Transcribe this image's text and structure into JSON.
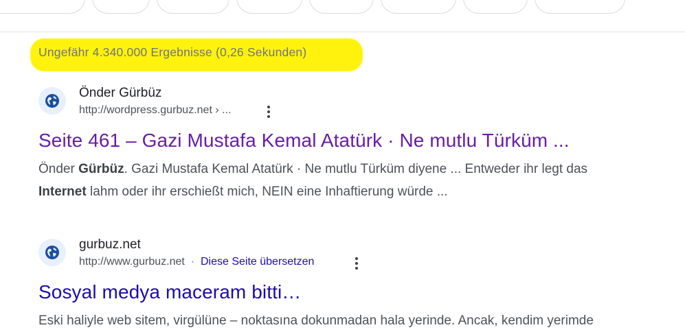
{
  "stats": {
    "text": "Ungefähr 4.340.000 Ergebnisse (0,26 Sekunden)"
  },
  "results": [
    {
      "site_name": "Önder Gürbüz",
      "url": "http://wordpress.gurbuz.net › ...",
      "title": "Seite 461 – Gazi Mustafa Kemal Atatürk · Ne mutlu Türküm ...",
      "snippet_parts": [
        {
          "t": "Önder "
        },
        {
          "t": "Gürbüz",
          "b": true
        },
        {
          "t": ". Gazi Mustafa Kemal Atatürk · Ne mutlu Türküm diyene ... Entweder ihr legt das "
        },
        {
          "t": "Internet",
          "b": true
        },
        {
          "t": " lahm oder ihr erschießt mich, NEIN eine Inhaftierung würde ..."
        }
      ]
    },
    {
      "site_name": "gurbuz.net",
      "url": "http://www.gurbuz.net",
      "translate": "Diese Seite übersetzen",
      "title": "Sosyal medya maceram bitti…",
      "snippet_parts": [
        {
          "t": "Eski haliyle web sitem, virgülüne – noktasına dokunmadan hala yerinde. Ancak, kendim yerimde"
        }
      ]
    }
  ],
  "colors": {
    "visited_link": "#681da8",
    "link": "#1a0dab",
    "highlight": "#fff200"
  },
  "icons": [
    "globe-icon",
    "more-vert-icon"
  ]
}
